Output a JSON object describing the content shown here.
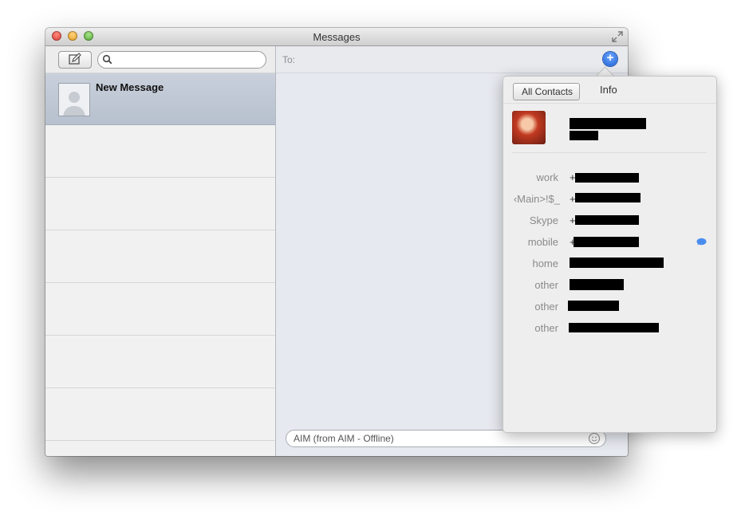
{
  "window": {
    "title": "Messages"
  },
  "sidebar": {
    "search": {
      "placeholder": ""
    },
    "conversations": [
      {
        "name": "New Message"
      }
    ]
  },
  "compose": {
    "to_label": "To:",
    "input_placeholder": "AIM (from AIM - Offline)"
  },
  "contact_popover": {
    "back_label": "All Contacts",
    "title": "Info",
    "fields": [
      {
        "label": "work",
        "value_prefix": "+"
      },
      {
        "label": "‹Main>!$_",
        "value_prefix": "+"
      },
      {
        "label": "Skype",
        "value_prefix": "+"
      },
      {
        "label": "mobile",
        "value_prefix": "+"
      },
      {
        "label": "home",
        "value_prefix": ""
      },
      {
        "label": "other",
        "value_prefix": ""
      },
      {
        "label": "other",
        "value_prefix": ""
      },
      {
        "label": "other",
        "value_prefix": ""
      }
    ]
  },
  "colors": {
    "accent_blue": "#1c5fd3",
    "selection": "#bfc7d4"
  }
}
